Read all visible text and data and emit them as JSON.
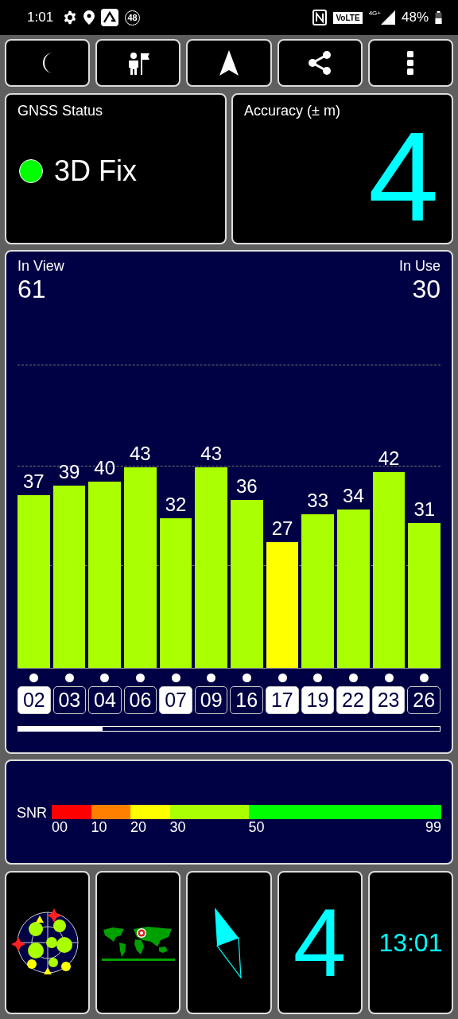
{
  "status_bar": {
    "time": "1:01",
    "notification_count": "48",
    "volte": "VoLTE",
    "network": "4G+",
    "battery": "48%"
  },
  "gnss_status": {
    "title": "GNSS Status",
    "fix": "3D Fix"
  },
  "accuracy": {
    "title": "Accuracy (± m)",
    "value": "4"
  },
  "signal_panel": {
    "in_view_label": "In View",
    "in_view": "61",
    "in_use_label": "In Use",
    "in_use": "30",
    "satellites": [
      {
        "id": "02",
        "snr": "37",
        "in_use": true,
        "color": "#aaff00"
      },
      {
        "id": "03",
        "snr": "39",
        "in_use": false,
        "color": "#aaff00"
      },
      {
        "id": "04",
        "snr": "40",
        "in_use": false,
        "color": "#aaff00"
      },
      {
        "id": "06",
        "snr": "43",
        "in_use": false,
        "color": "#aaff00"
      },
      {
        "id": "07",
        "snr": "32",
        "in_use": true,
        "color": "#aaff00"
      },
      {
        "id": "09",
        "snr": "43",
        "in_use": false,
        "color": "#aaff00"
      },
      {
        "id": "16",
        "snr": "36",
        "in_use": false,
        "color": "#aaff00"
      },
      {
        "id": "17",
        "snr": "27",
        "in_use": true,
        "color": "#ffff00"
      },
      {
        "id": "19",
        "snr": "33",
        "in_use": true,
        "color": "#aaff00"
      },
      {
        "id": "22",
        "snr": "34",
        "in_use": true,
        "color": "#aaff00"
      },
      {
        "id": "23",
        "snr": "42",
        "in_use": true,
        "color": "#aaff00"
      },
      {
        "id": "26",
        "snr": "31",
        "in_use": false,
        "color": "#aaff00"
      }
    ]
  },
  "snr_legend": {
    "label": "SNR",
    "segments": [
      {
        "from": "00",
        "color": "#ff0000"
      },
      {
        "from": "10",
        "color": "#ff8000"
      },
      {
        "from": "20",
        "color": "#ffff00"
      },
      {
        "from": "30",
        "color": "#aaff00"
      },
      {
        "from": "50",
        "color": "#00ff00"
      }
    ],
    "max": "99"
  },
  "tiles": {
    "accuracy": "4",
    "time": "13:01"
  }
}
